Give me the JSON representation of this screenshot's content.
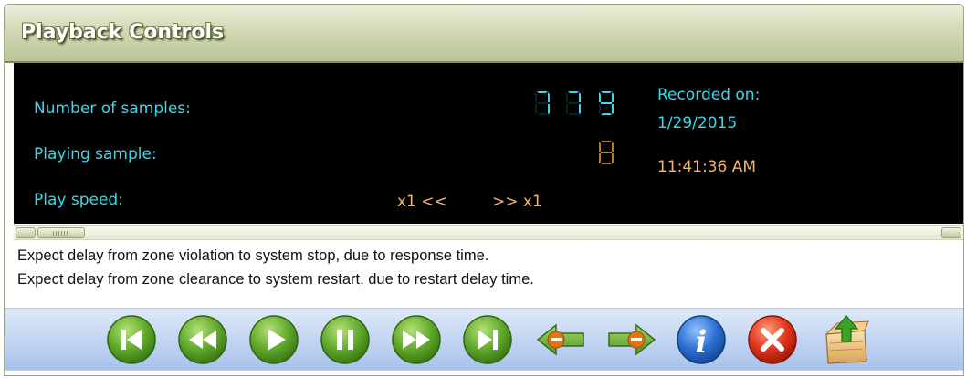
{
  "window": {
    "title": "Playback Controls"
  },
  "display": {
    "samples_label": "Number of samples:",
    "samples_digits": [
      "7",
      "7",
      "9"
    ],
    "playing_label": "Playing sample:",
    "playing_digit": "8",
    "speed_label": "Play speed:",
    "speed_slower": "x1 <<",
    "speed_faster": ">> x1",
    "recorded_label": "Recorded on:",
    "recorded_date": "1/29/2015",
    "recorded_time": "11:41:36 AM"
  },
  "messages": [
    "Expect delay from zone violation to system stop, due to response time.",
    "Expect delay from zone clearance to system restart, due to restart delay time."
  ],
  "toolbar": {
    "buttons": [
      {
        "name": "first-sample",
        "icon": "skip-to-start-icon"
      },
      {
        "name": "rewind",
        "icon": "rewind-icon"
      },
      {
        "name": "play",
        "icon": "play-icon"
      },
      {
        "name": "pause",
        "icon": "pause-icon"
      },
      {
        "name": "fast-forward",
        "icon": "fast-forward-icon"
      },
      {
        "name": "last-sample",
        "icon": "skip-to-end-icon"
      },
      {
        "name": "speed-down",
        "icon": "arrow-left-minus-icon"
      },
      {
        "name": "speed-up",
        "icon": "arrow-right-minus-icon"
      },
      {
        "name": "info",
        "icon": "info-icon"
      },
      {
        "name": "close",
        "icon": "close-icon"
      },
      {
        "name": "export",
        "icon": "export-icon"
      }
    ]
  },
  "colors": {
    "display_bg": "#000000",
    "display_label": "#3fd6e6",
    "display_value": "#f0b66a",
    "green_button": "#5fa82a",
    "info_button": "#2c6fd0",
    "close_button": "#e0341c"
  }
}
